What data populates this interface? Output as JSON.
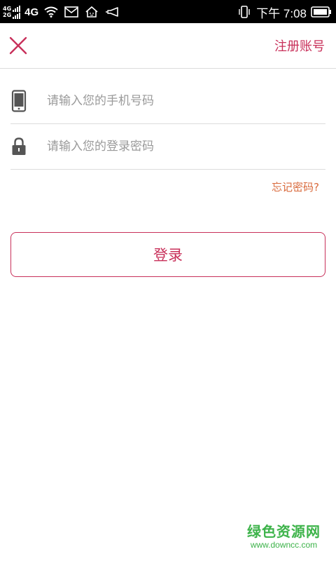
{
  "status_bar": {
    "sim1_label": "4G",
    "sim2_label": "2G",
    "network_label": "4G",
    "time": "下午 7:08",
    "icons": [
      "signal-icon",
      "wifi-icon",
      "message-icon",
      "home-icon",
      "notification-icon",
      "vibrate-icon",
      "battery-icon"
    ]
  },
  "header": {
    "close_icon": "close-icon",
    "register_label": "注册账号"
  },
  "form": {
    "phone": {
      "icon": "phone-icon",
      "placeholder": "请输入您的手机号码",
      "value": ""
    },
    "password": {
      "icon": "lock-icon",
      "placeholder": "请输入您的登录密码",
      "value": ""
    },
    "forgot_label": "忘记密码?",
    "login_label": "登录"
  },
  "watermark": {
    "title": "绿色资源网",
    "url": "www.downcc.com"
  },
  "colors": {
    "accent": "#c8305a",
    "forgot": "#d96a3c",
    "watermark": "#3db34a",
    "divider": "#dcdcdc"
  }
}
